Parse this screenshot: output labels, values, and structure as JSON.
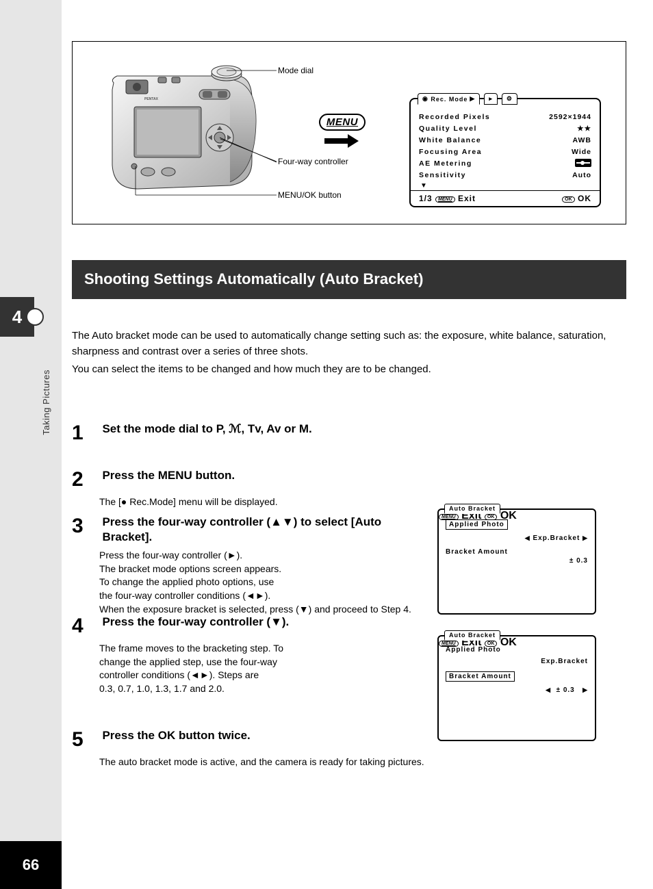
{
  "page_number": "66",
  "side_tab_num": "4",
  "side_label": "Taking Pictures",
  "callouts": {
    "mode_dial": "Mode dial",
    "four_way": "Four-way controller",
    "menu_ok": "MENU/OK button"
  },
  "menu_button_label": "MENU",
  "rec_menu": {
    "tab": "Rec. Mode",
    "rows": [
      {
        "label": "Recorded Pixels",
        "value": "2592×1944"
      },
      {
        "label": "Quality Level",
        "value": "★★"
      },
      {
        "label": "White Balance",
        "value": "AWB"
      },
      {
        "label": "Focusing Area",
        "value": "Wide"
      },
      {
        "label": "AE Metering",
        "value": "[meter]"
      },
      {
        "label": "Sensitivity",
        "value": "Auto"
      }
    ],
    "page": "1/3",
    "exit": "Exit",
    "ok": "OK",
    "menu_small": "MENU",
    "ok_small": "OK"
  },
  "heading": "Shooting Settings Automatically (Auto Bracket)",
  "intro": [
    "The Auto bracket mode can be used to automatically change setting such as: the exposure, white balance, saturation, sharpness and contrast over a series of three shots.",
    "You can select the items to be changed and how much they are to be changed."
  ],
  "steps": {
    "s1": {
      "num": "1",
      "head": "Set the mode dial to P, ℳ, Tv, Av or M."
    },
    "s2": {
      "num": "2",
      "head": "Press the MENU button.",
      "body": "The [● Rec.Mode] menu will be displayed."
    },
    "s3": {
      "num": "3",
      "head": "Press the four-way controller (▲▼) to select [Auto Bracket].",
      "body": "Press the four-way controller (►).\nThe bracket mode options screen appears.\nTo change the applied photo options, use\nthe four-way controller conditions (◄►).\nWhen the exposure bracket is selected, press (▼) and proceed to Step 4."
    },
    "s4": {
      "num": "4",
      "head": "Press the four-way controller (▼).",
      "body": "The frame moves to the bracketing step. To\nchange the applied step, use the four-way\ncontroller conditions (◄►). Steps are\n0.3, 0.7, 1.0, 1.3, 1.7 and 2.0."
    },
    "s5": {
      "num": "5",
      "head": "Press the OK button twice.",
      "body": "The auto bracket mode is active, and the camera is ready for taking pictures."
    }
  },
  "bracket_panel": {
    "tab": "Auto Bracket",
    "applied": "Applied Photo",
    "amount": "Bracket Amount",
    "value_right": "Exp.Bracket",
    "step_value": "±  0.3",
    "exit": "Exit",
    "ok": "OK"
  }
}
